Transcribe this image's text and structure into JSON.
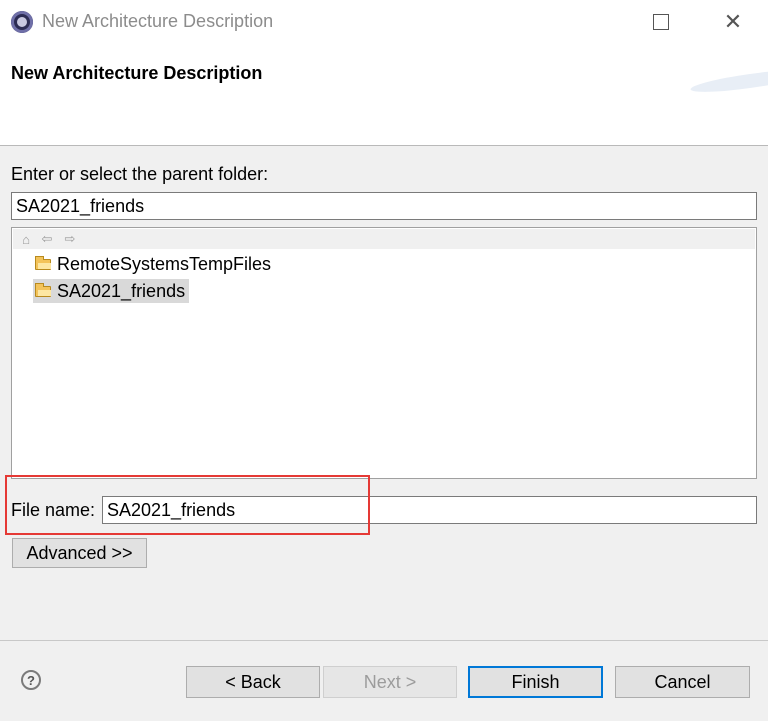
{
  "window": {
    "title": "New Architecture Description",
    "maximize_icon": "maximize-icon",
    "close_icon": "close-icon"
  },
  "banner": {
    "title": "New Architecture Description"
  },
  "parent_folder": {
    "label": "Enter or select the parent folder:",
    "value": "SA2021_friends"
  },
  "tree": {
    "toolbar_icons": [
      "home-icon",
      "back-arrow-icon",
      "forward-arrow-icon"
    ],
    "items": [
      {
        "label": "RemoteSystemsTempFiles",
        "selected": false,
        "icon": "folder-icon"
      },
      {
        "label": "SA2021_friends",
        "selected": true,
        "icon": "folder-icon"
      }
    ]
  },
  "file_name": {
    "label": "File name:",
    "value": "SA2021_friends"
  },
  "advanced_label": "Advanced >>",
  "footer": {
    "help_icon": "help-icon",
    "back_label": "< Back",
    "next_label": "Next >",
    "finish_label": "Finish",
    "cancel_label": "Cancel"
  },
  "colors": {
    "highlight": "#e53935",
    "default_button_border": "#0078d7",
    "selection": "#d9d9d9"
  }
}
